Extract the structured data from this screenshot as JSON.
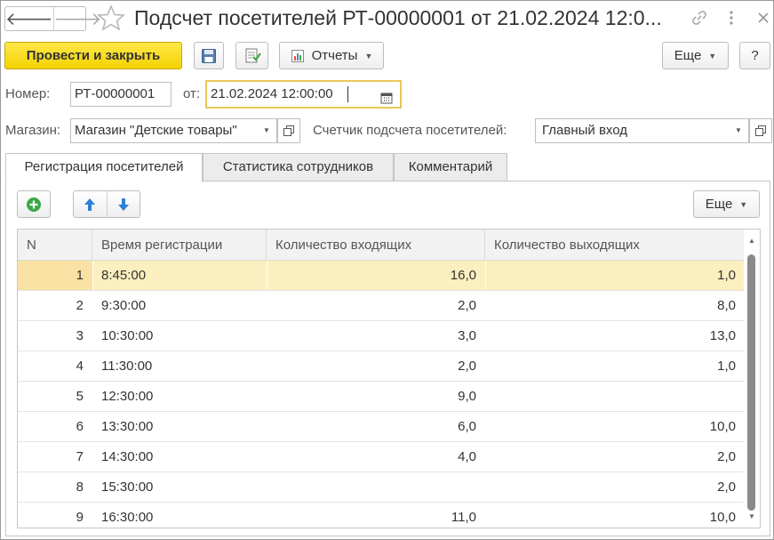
{
  "window": {
    "title": "Подсчет посетителей РТ-00000001 от 21.02.2024 12:0..."
  },
  "toolbar": {
    "post_close_label": "Провести и закрыть",
    "reports_label": "Отчеты",
    "more_label": "Еще",
    "help_label": "?"
  },
  "form": {
    "number_label": "Номер:",
    "number_value": "РТ-00000001",
    "date_label": "от:",
    "date_value": "21.02.2024 12:00:00",
    "store_label": "Магазин:",
    "store_value": "Магазин \"Детские товары\"",
    "counter_label": "Счетчик подсчета посетителей:",
    "counter_value": "Главный вход"
  },
  "tabs": [
    {
      "label": "Регистрация посетителей",
      "active": true
    },
    {
      "label": "Статистика сотрудников",
      "active": false
    },
    {
      "label": "Комментарий",
      "active": false
    }
  ],
  "table_toolbar": {
    "more_label": "Еще"
  },
  "table": {
    "columns": [
      "N",
      "Время регистрации",
      "Количество входящих",
      "Количество выходящих"
    ],
    "rows": [
      {
        "n": "1",
        "time": "8:45:00",
        "in": "16,0",
        "out": "1,0",
        "selected": true
      },
      {
        "n": "2",
        "time": "9:30:00",
        "in": "2,0",
        "out": "8,0"
      },
      {
        "n": "3",
        "time": "10:30:00",
        "in": "3,0",
        "out": "13,0"
      },
      {
        "n": "4",
        "time": "11:30:00",
        "in": "2,0",
        "out": "1,0"
      },
      {
        "n": "5",
        "time": "12:30:00",
        "in": "9,0",
        "out": ""
      },
      {
        "n": "6",
        "time": "13:30:00",
        "in": "6,0",
        "out": "10,0"
      },
      {
        "n": "7",
        "time": "14:30:00",
        "in": "4,0",
        "out": "2,0"
      },
      {
        "n": "8",
        "time": "15:30:00",
        "in": "",
        "out": "2,0"
      },
      {
        "n": "9",
        "time": "16:30:00",
        "in": "11,0",
        "out": "10,0"
      }
    ]
  },
  "colors": {
    "primary_button": "#f4d200",
    "selected_row": "#fbefbf",
    "focus_border": "#e8c75a",
    "add_icon": "#3aa845",
    "arrow_icon": "#2f7fd6"
  }
}
